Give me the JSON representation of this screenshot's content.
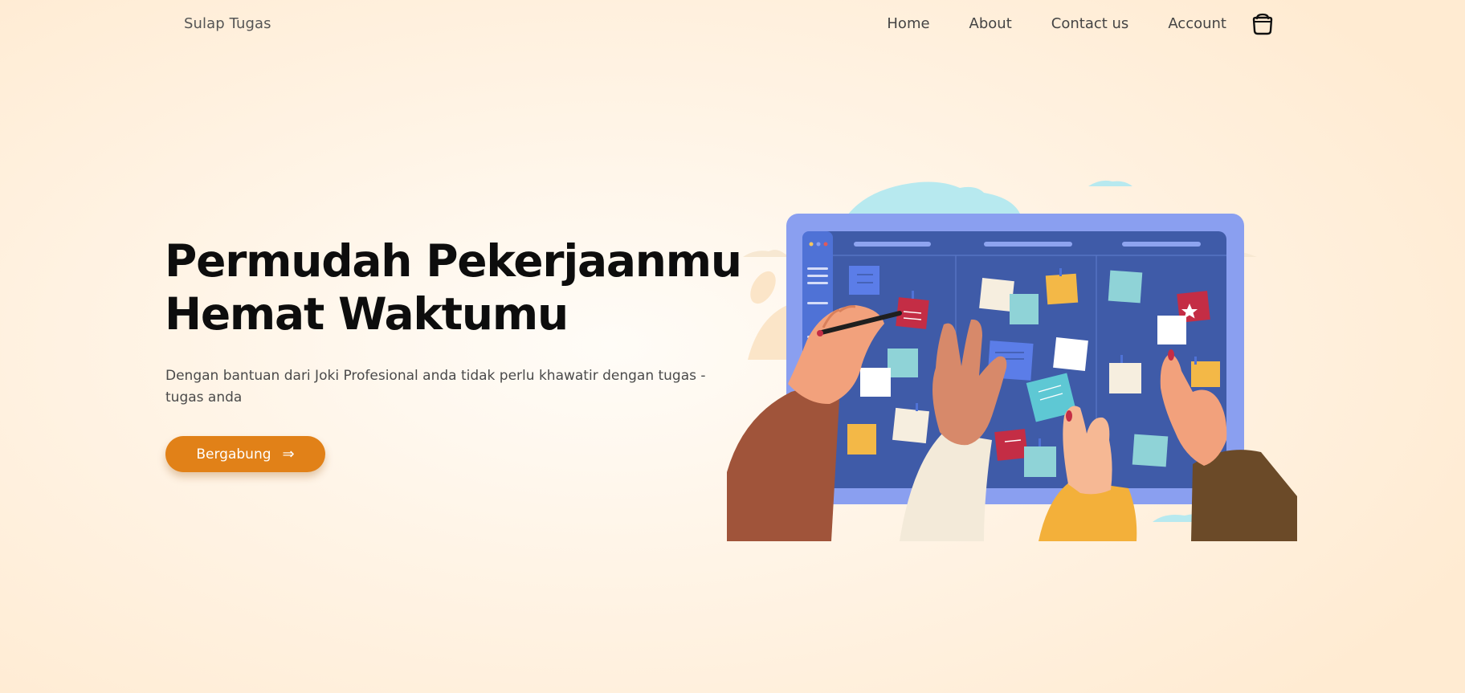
{
  "brand": "Sulap Tugas",
  "nav": {
    "home": "Home",
    "about": "About",
    "contact": "Contact us",
    "account": "Account",
    "cart_icon": "shopping-bag-icon"
  },
  "hero": {
    "title_line1": "Permudah Pekerjaanmu",
    "title_line2": "Hemat Waktumu",
    "description": "Dengan bantuan dari Joki Profesional anda tidak perlu khawatir dengan tugas - tugas anda",
    "cta_label": "Bergabung",
    "cta_icon": "⇒"
  },
  "colors": {
    "accent": "#e18118",
    "board_frame": "#8a9ff0",
    "board": "#3f5ba8"
  }
}
